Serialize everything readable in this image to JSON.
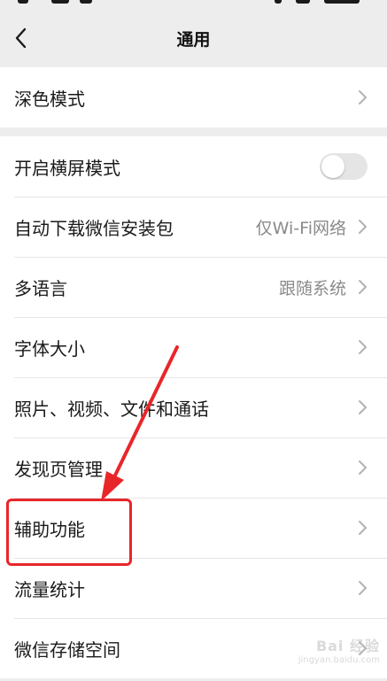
{
  "nav": {
    "title": "通用"
  },
  "section_dark": {
    "items": [
      {
        "label": "深色模式"
      }
    ]
  },
  "section_main": {
    "items": [
      {
        "label": "开启横屏模式",
        "toggle": false
      },
      {
        "label": "自动下载微信安装包",
        "value": "仅Wi-Fi网络"
      },
      {
        "label": "多语言",
        "value": "跟随系统"
      },
      {
        "label": "字体大小"
      },
      {
        "label": "照片、视频、文件和通话"
      },
      {
        "label": "发现页管理"
      },
      {
        "label": "辅助功能"
      },
      {
        "label": "流量统计"
      },
      {
        "label": "微信存储空间"
      }
    ]
  },
  "annotation": {
    "highlight_color": "#e8262a"
  },
  "watermark": {
    "text": "Bai 经验",
    "url": "jingyan.baidu.com"
  },
  "colors": {
    "background": "#ededed",
    "row_bg": "#ffffff",
    "value_text": "#8a8a8a",
    "toggle_off": "#e5e5e5"
  },
  "icons": [
    "chevron-left-icon",
    "chevron-right-icon"
  ]
}
